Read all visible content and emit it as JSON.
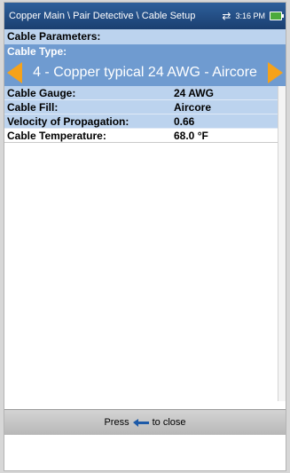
{
  "titlebar": {
    "breadcrumb": "Copper Main \\ Pair Detective \\ Cable Setup",
    "time": "3:16 PM"
  },
  "section_header": "Cable Parameters:",
  "cable_type": {
    "label": "Cable Type:",
    "value": "4 - Copper typical 24 AWG - Aircore"
  },
  "params": [
    {
      "label": "Cable Gauge:",
      "value": "24 AWG"
    },
    {
      "label": "Cable Fill:",
      "value": "Aircore"
    },
    {
      "label": "Velocity of Propagation:",
      "value": "0.66"
    },
    {
      "label": "Cable Temperature:",
      "value": "68.0 °F"
    }
  ],
  "footer": {
    "press_label": "Press",
    "close_label": "to close"
  },
  "colors": {
    "titlebar": "#1b3f70",
    "selector": "#6f9bd0",
    "accent_arrow": "#f5a21a",
    "row": "#bcd3ee"
  }
}
